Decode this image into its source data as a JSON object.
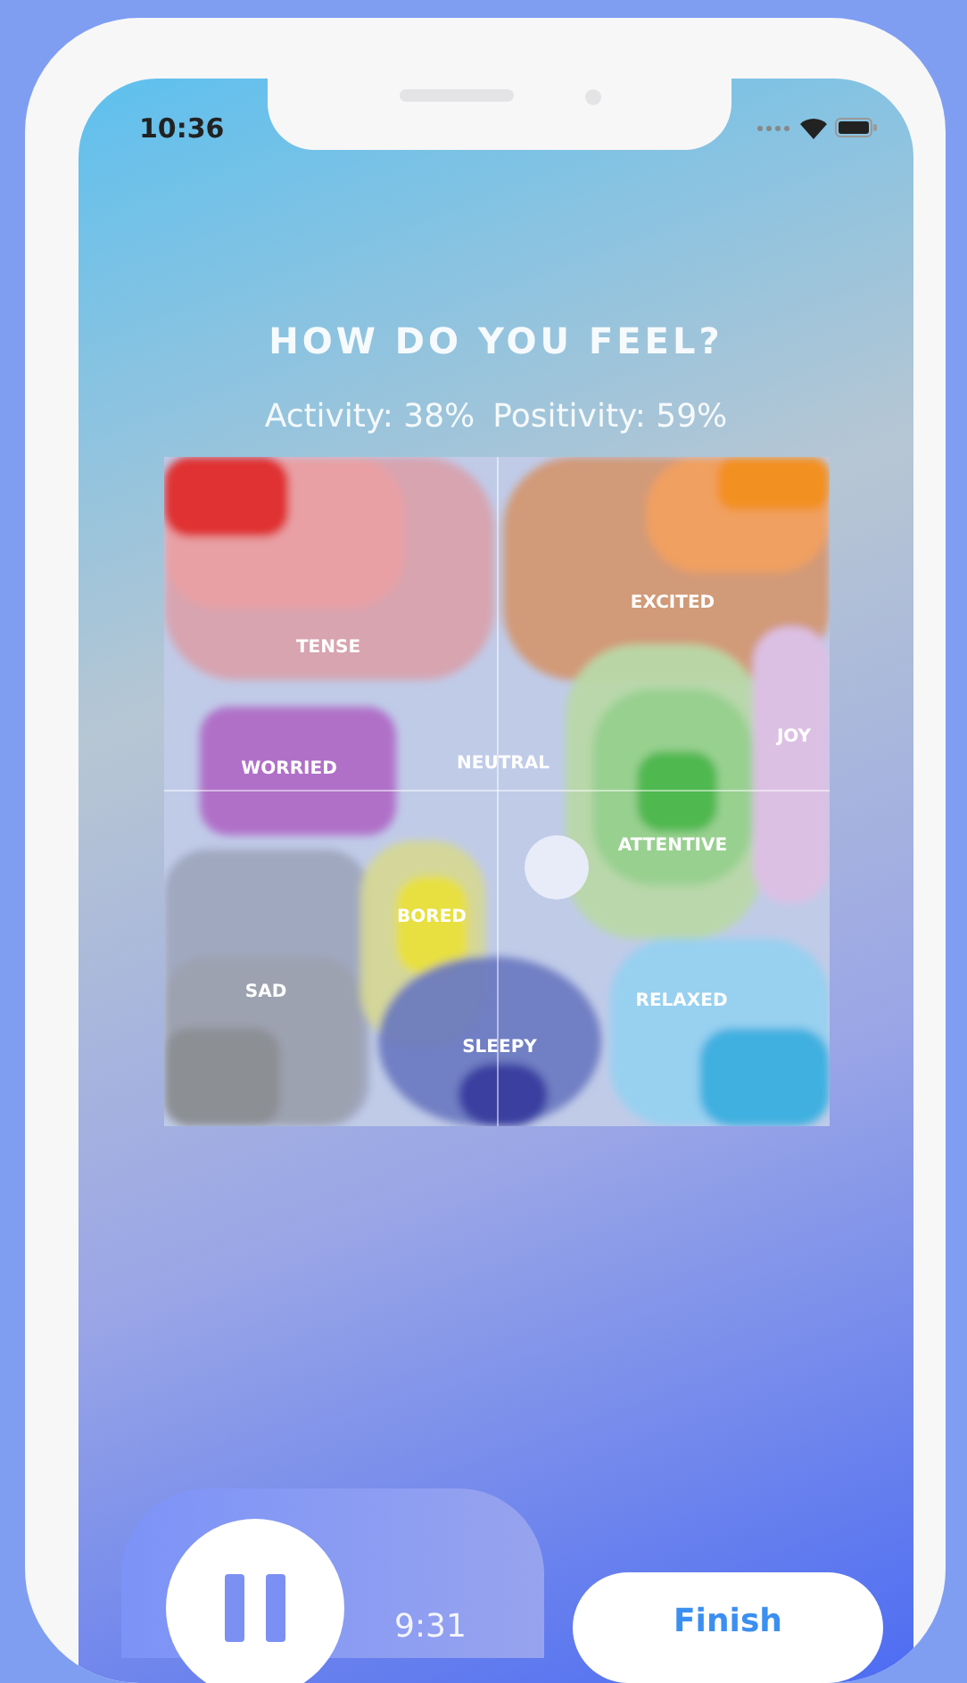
{
  "status_bar": {
    "time": "10:36"
  },
  "title": "HOW DO YOU FEEL?",
  "readings": [
    "Activity: 38%",
    "Positivity: 59%"
  ],
  "mood_map": {
    "labels": [
      "TENSE",
      "EXCITED",
      "WORRIED",
      "NEUTRAL",
      "JOY",
      "ATTENTIVE",
      "BORED",
      "SAD",
      "RELAXED",
      "SLEEPY"
    ]
  },
  "player": {
    "timer": "9:31"
  },
  "finish_button": "Finish"
}
